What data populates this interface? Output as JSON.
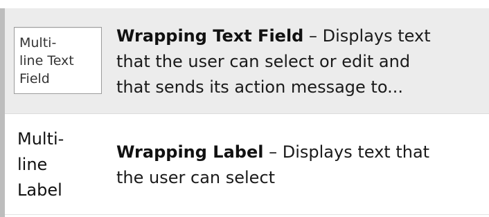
{
  "library_items": [
    {
      "preview_lines": [
        "Multi-",
        "line Text",
        "Field"
      ],
      "title": "Wrapping Text Field",
      "separator": " – ",
      "description_lines": [
        "Displays text",
        "that the user can select or edit and",
        "that sends its action message to..."
      ],
      "selected": true
    },
    {
      "preview_lines": [
        "Multi-",
        "line",
        "Label"
      ],
      "title": "Wrapping Label",
      "separator": " – ",
      "description_lines": [
        "Displays text that",
        "the user can select"
      ],
      "selected": false
    }
  ],
  "colors": {
    "selected_row_background": "#ececec",
    "row_background": "#ffffff",
    "left_border": "#bdbdbd",
    "field_border": "#9c9c9c"
  }
}
